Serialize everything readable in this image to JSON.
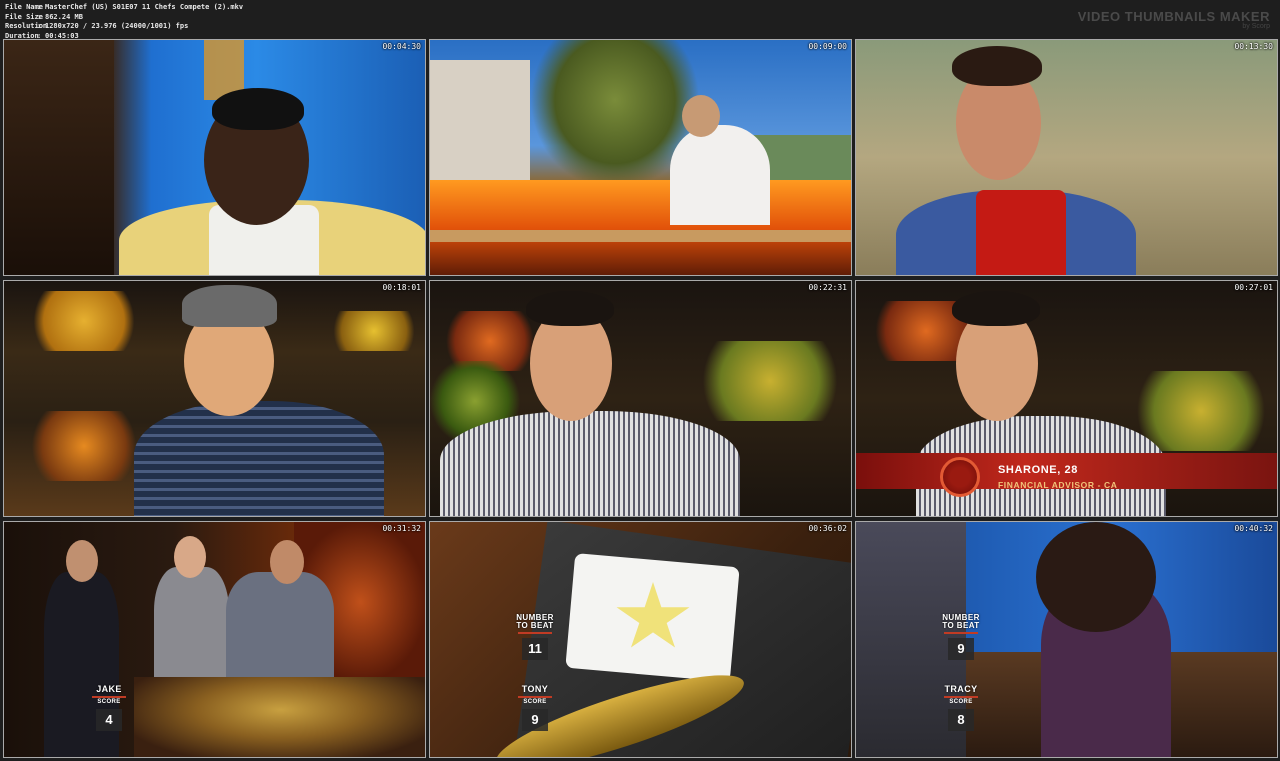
{
  "meta": {
    "file_name_label": "File Name",
    "file_name": "MasterChef (US) S01E07 11 Chefs Compete (2).mkv",
    "file_size_label": "File Size",
    "file_size": "862.24 MB",
    "resolution_label": "Resolution",
    "resolution": "1280x720 / 23.976 (24000/1001) fps",
    "duration_label": "Duration",
    "duration": "00:45:03",
    "separator": ":"
  },
  "brand": {
    "title": "VIDEO THUMBNAILS MAKER",
    "subtitle": "by Scorp"
  },
  "thumbnails": [
    {
      "timestamp": "00:04:30"
    },
    {
      "timestamp": "00:09:00"
    },
    {
      "timestamp": "00:13:30"
    },
    {
      "timestamp": "00:18:01"
    },
    {
      "timestamp": "00:22:31"
    },
    {
      "timestamp": "00:27:01",
      "caption_name": "SHARONE, 28",
      "caption_role": "FINANCIAL ADVISOR - CA"
    },
    {
      "timestamp": "00:31:32",
      "contestant": "JAKE",
      "score_label": "SCORE",
      "score": "4"
    },
    {
      "timestamp": "00:36:02",
      "beat_label_1": "NUMBER",
      "beat_label_2": "TO BEAT",
      "beat_value": "11",
      "contestant": "TONY",
      "score_label": "SCORE",
      "score": "9"
    },
    {
      "timestamp": "00:40:32",
      "beat_label_1": "NUMBER",
      "beat_label_2": "TO BEAT",
      "beat_value": "9",
      "contestant": "TRACY",
      "score_label": "SCORE",
      "score": "8"
    }
  ]
}
